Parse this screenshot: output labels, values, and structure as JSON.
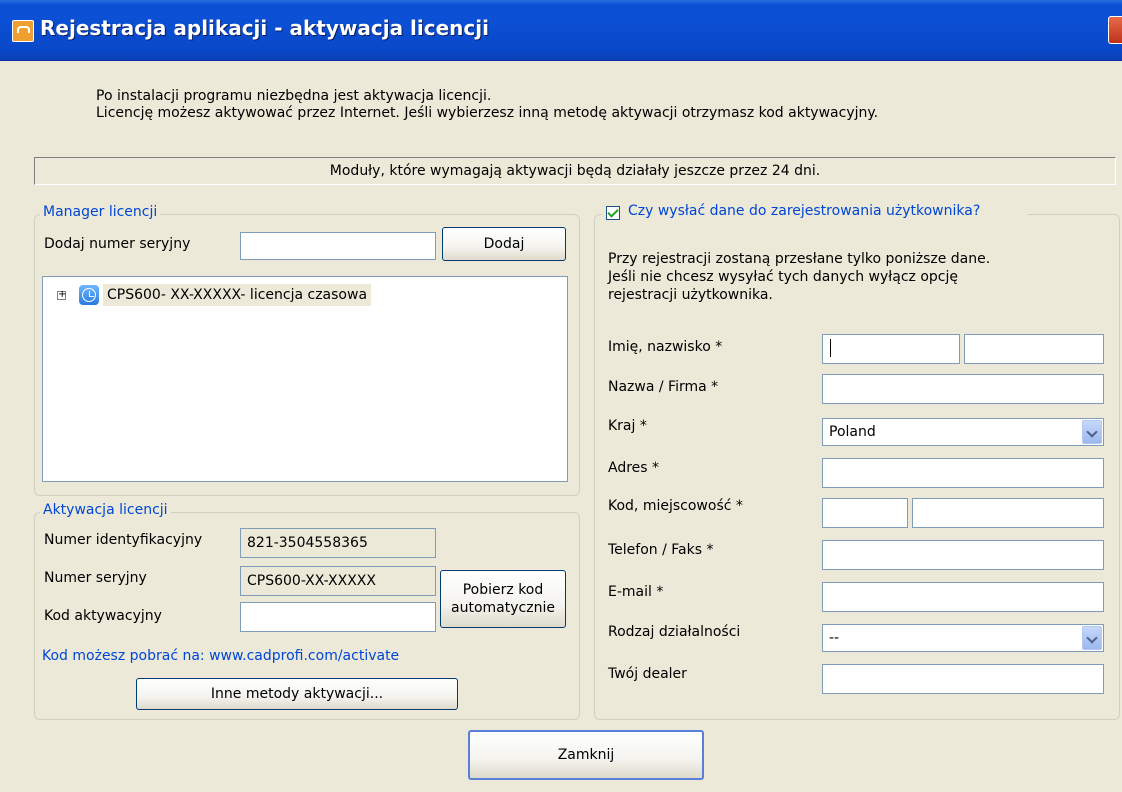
{
  "window": {
    "title": "Rejestracja aplikacji - aktywacja licencji"
  },
  "intro": {
    "line1": "Po instalacji programu niezbędna jest aktywacja licencji.",
    "line2": "Licencję możesz aktywować przez Internet. Jeśli wybierzesz inną metodę aktywacji otrzymasz kod aktywacyjny."
  },
  "info_bar": "Moduły, które wymagają aktywacji będą działały jeszcze przez 24 dni.",
  "license_manager": {
    "legend": "Manager licencji",
    "serial_label": "Dodaj numer seryjny",
    "serial_value": "",
    "add_button": "Dodaj",
    "tree_items": [
      {
        "label": "CPS600- XX-XXXXX- licencja czasowa",
        "icon": "clock-icon",
        "expander": "⊞"
      }
    ]
  },
  "activation": {
    "legend": "Aktywacja licencji",
    "id_label": "Numer identyfikacyjny",
    "id_value": "821-3504558365",
    "serial_label": "Numer seryjny",
    "serial_value": "CPS600-XX-XXXXX",
    "code_label": "Kod aktywacyjny",
    "code_value": "",
    "fetch_button_line1": "Pobierz kod",
    "fetch_button_line2": "automatycznie",
    "download_hint": "Kod możesz pobrać na: www.cadprofi.com/activate",
    "other_methods_button": "Inne metody aktywacji..."
  },
  "registration": {
    "checkbox_label": "Czy wysłać dane do zarejestrowania użytkownika?",
    "checked": true,
    "description_line1": "Przy rejestracji zostaną przesłane tylko poniższe dane.",
    "description_line2": "Jeśli nie chcesz wysyłać tych danych wyłącz opcję",
    "description_line3": "rejestracji użytkownika.",
    "fields": {
      "name_label": "Imię, nazwisko *",
      "company_label": "Nazwa / Firma *",
      "country_label": "Kraj *",
      "country_value": "Poland",
      "address_label": "Adres *",
      "city_label": "Kod, miejscowość *",
      "phone_label": "Telefon / Faks *",
      "email_label": "E-mail *",
      "business_label": "Rodzaj działalności",
      "business_value": "--",
      "dealer_label": "Twój dealer"
    }
  },
  "close_button": "Zamknij"
}
